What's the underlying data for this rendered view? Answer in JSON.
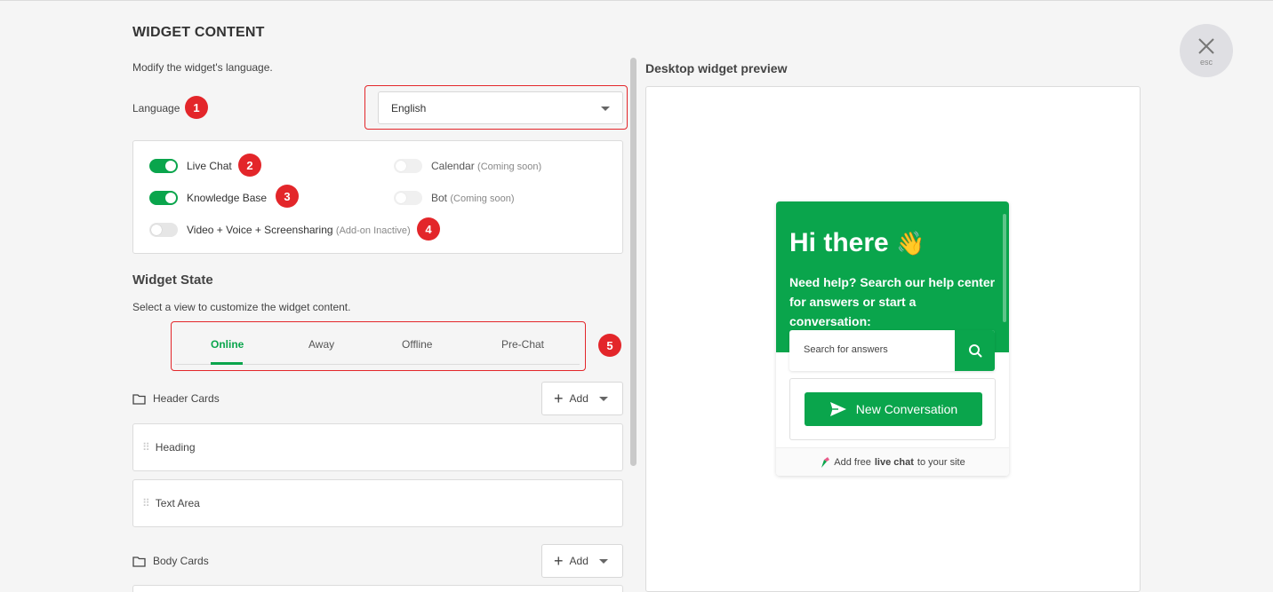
{
  "header": {
    "title": "WIDGET CONTENT",
    "subtitle": "Modify the widget's language."
  },
  "language": {
    "label": "Language",
    "selected": "English"
  },
  "badges": [
    "1",
    "2",
    "3",
    "4",
    "5"
  ],
  "features": {
    "live_chat": {
      "label": "Live Chat",
      "enabled": true
    },
    "knowledge_base": {
      "label": "Knowledge Base",
      "enabled": true
    },
    "video": {
      "label": "Video + Voice + Screensharing",
      "note": "(Add-on Inactive)",
      "enabled": false
    },
    "calendar": {
      "label": "Calendar",
      "note": "(Coming soon)",
      "enabled": false
    },
    "bot": {
      "label": "Bot",
      "note": "(Coming soon)",
      "enabled": false
    }
  },
  "widget_state": {
    "title": "Widget State",
    "subtitle": "Select a view to customize the widget content.",
    "tabs": [
      {
        "label": "Online",
        "active": true
      },
      {
        "label": "Away",
        "active": false
      },
      {
        "label": "Offline",
        "active": false
      },
      {
        "label": "Pre-Chat",
        "active": false
      }
    ]
  },
  "header_cards": {
    "label": "Header Cards",
    "add_label": "Add",
    "items": [
      "Heading",
      "Text Area"
    ]
  },
  "body_cards": {
    "label": "Body Cards",
    "add_label": "Add"
  },
  "preview": {
    "title": "Desktop widget preview",
    "greeting": "Hi there",
    "greeting_emoji": "👋",
    "intro": "Need help? Search our help center for answers or start a conversation:",
    "search_placeholder": "Search for answers",
    "new_conversation": "New Conversation",
    "footer_prefix": "Add free",
    "footer_bold": "live chat",
    "footer_suffix": "to your site"
  },
  "close": {
    "label": "esc"
  },
  "colors": {
    "accent": "#0aa54c",
    "badge": "#e3262a"
  }
}
